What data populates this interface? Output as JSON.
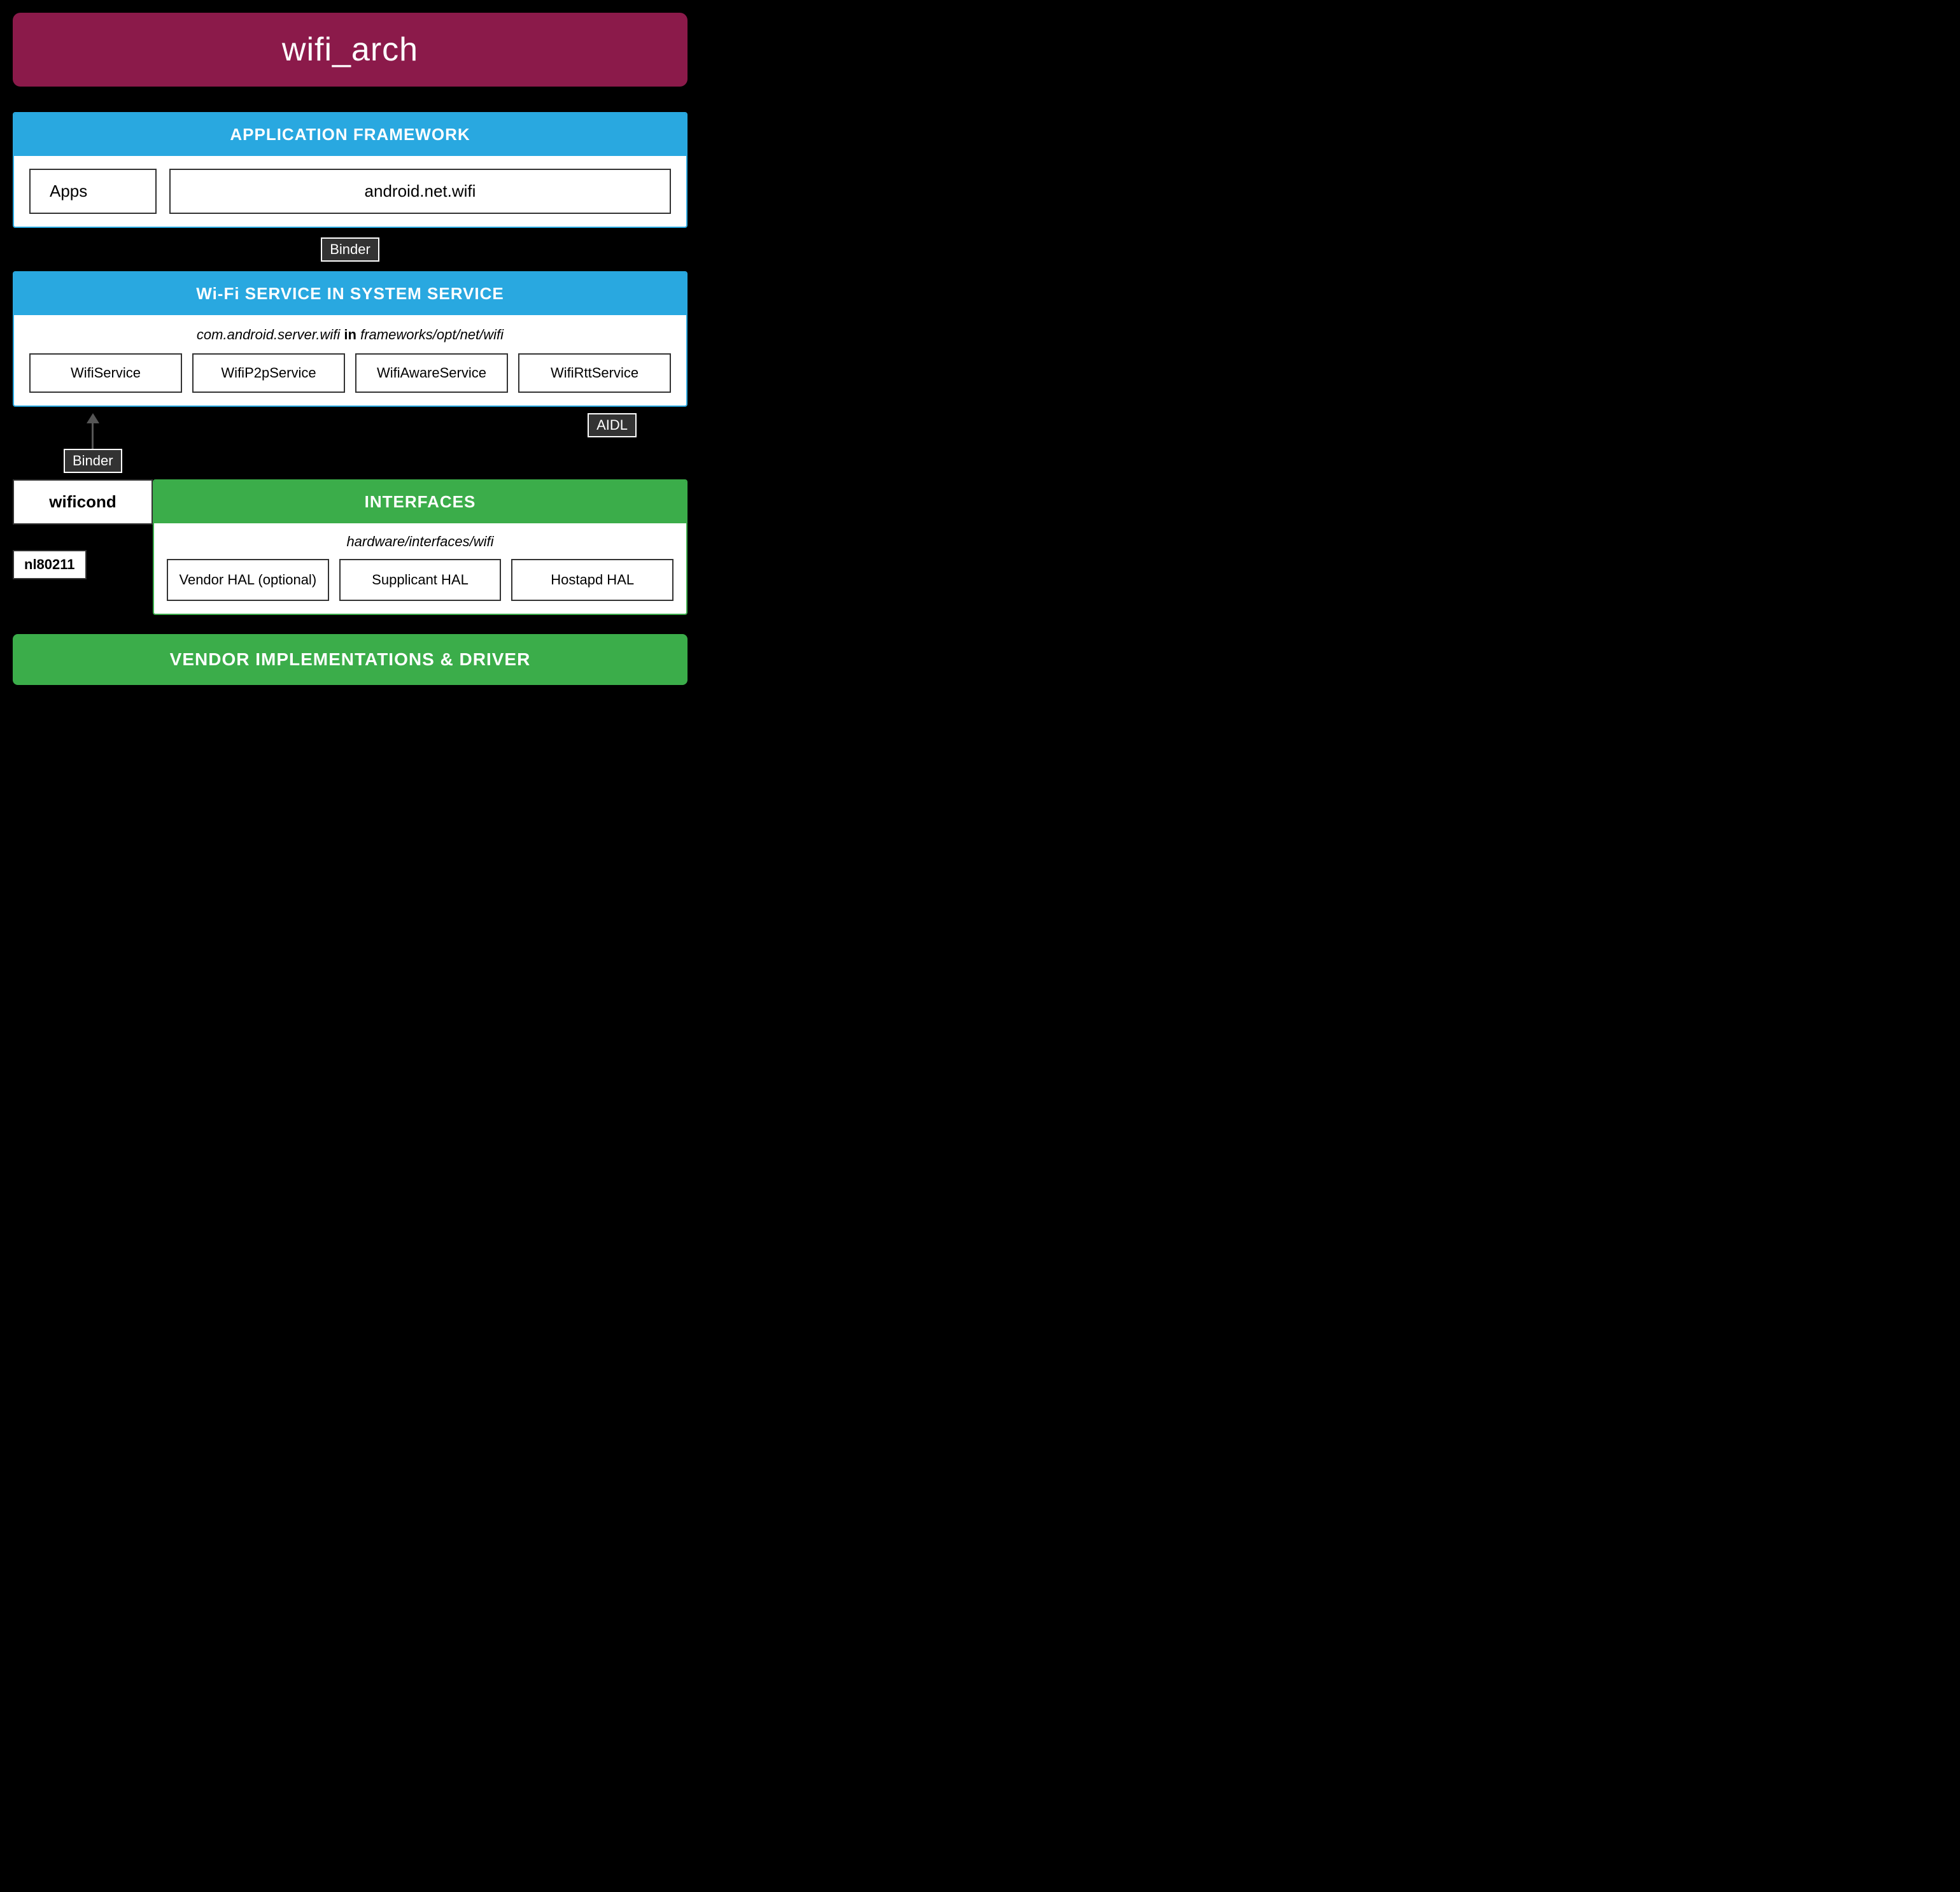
{
  "title": "wifi_arch",
  "titleBg": "#8B1A4A",
  "appFramework": {
    "header": "APPLICATION FRAMEWORK",
    "headerBg": "#29A8E0",
    "items": [
      {
        "label": "Apps"
      },
      {
        "label": "android.net.wifi"
      }
    ]
  },
  "binder1": {
    "label": "Binder"
  },
  "wifiService": {
    "header": "Wi-Fi SERVICE IN SYSTEM SERVICE",
    "headerBg": "#29A8E0",
    "subtitle_pre": "com.android.server.wifi",
    "subtitle_bold": "in",
    "subtitle_post": "frameworks/opt/net/wifi",
    "items": [
      {
        "label": "WifiService"
      },
      {
        "label": "WifiP2pService"
      },
      {
        "label": "WifiAwareService"
      },
      {
        "label": "WifiRttService"
      }
    ]
  },
  "binder2": {
    "label": "Binder"
  },
  "aidl": {
    "label": "AIDL"
  },
  "wificond": {
    "label": "wificond"
  },
  "nl80211": {
    "label": "nl80211"
  },
  "interfaces": {
    "header": "INTERFACES",
    "headerBg": "#3BAD4A",
    "subtitle": "hardware/interfaces/wifi",
    "items": [
      {
        "label": "Vendor HAL (optional)"
      },
      {
        "label": "Supplicant HAL"
      },
      {
        "label": "Hostapd HAL"
      }
    ]
  },
  "vendorBar": {
    "label": "VENDOR IMPLEMENTATIONS & DRIVER",
    "bg": "#3BAD4A"
  }
}
